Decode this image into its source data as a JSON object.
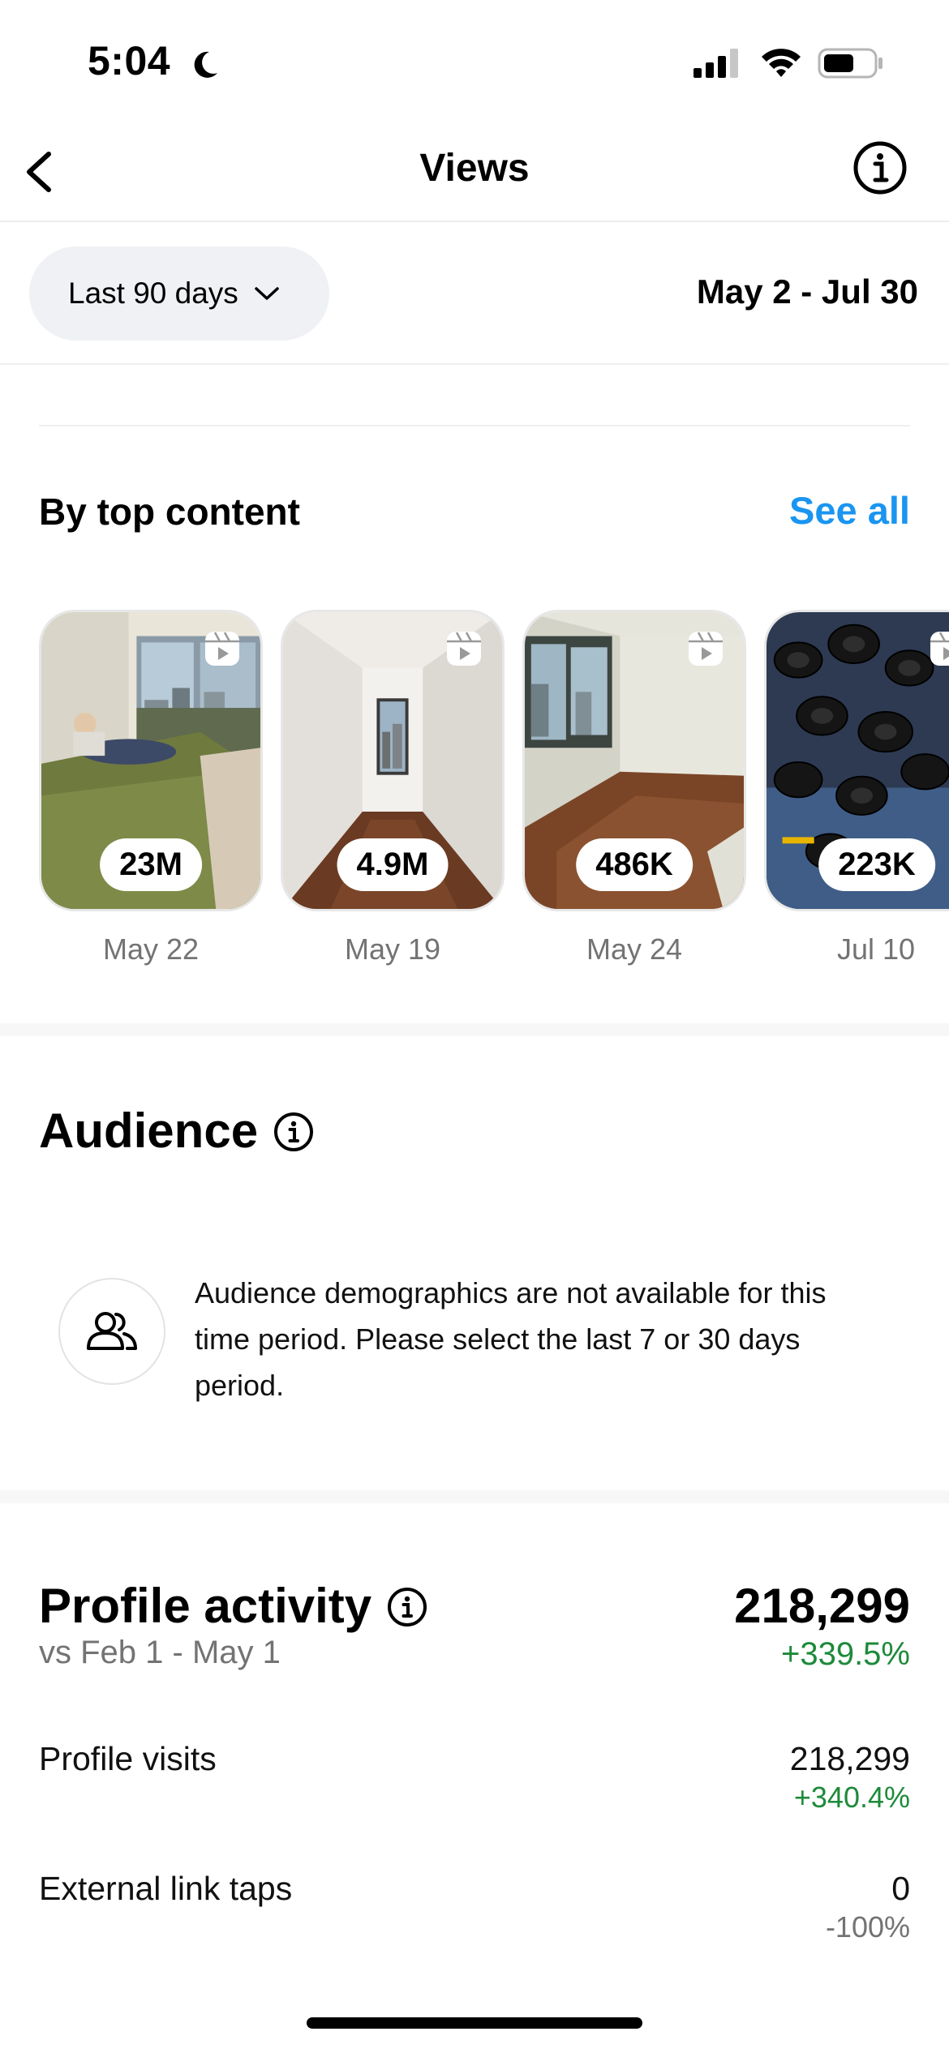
{
  "status_bar": {
    "time": "5:04"
  },
  "header": {
    "title": "Views"
  },
  "filter": {
    "range_label": "Last 90 days",
    "date_range": "May 2 - Jul 30"
  },
  "top_content": {
    "title": "By top content",
    "see_all": "See all",
    "items": [
      {
        "views": "23M",
        "date": "May 22"
      },
      {
        "views": "4.9M",
        "date": "May 19"
      },
      {
        "views": "486K",
        "date": "May 24"
      },
      {
        "views": "223K",
        "date": "Jul 10"
      }
    ]
  },
  "audience": {
    "title": "Audience",
    "message": "Audience demographics are not available for this time period. Please select the last 7 or 30 days period."
  },
  "profile_activity": {
    "title": "Profile activity",
    "total": "218,299",
    "comparison": "vs Feb 1 - May 1",
    "total_change": "+339.5%",
    "metrics": [
      {
        "label": "Profile visits",
        "value": "218,299",
        "change": "+340.4%"
      },
      {
        "label": "External link taps",
        "value": "0",
        "change": "-100%"
      }
    ]
  },
  "colors": {
    "accent": "#1a95f0",
    "positive": "#1d8a3a",
    "muted": "#737373"
  }
}
